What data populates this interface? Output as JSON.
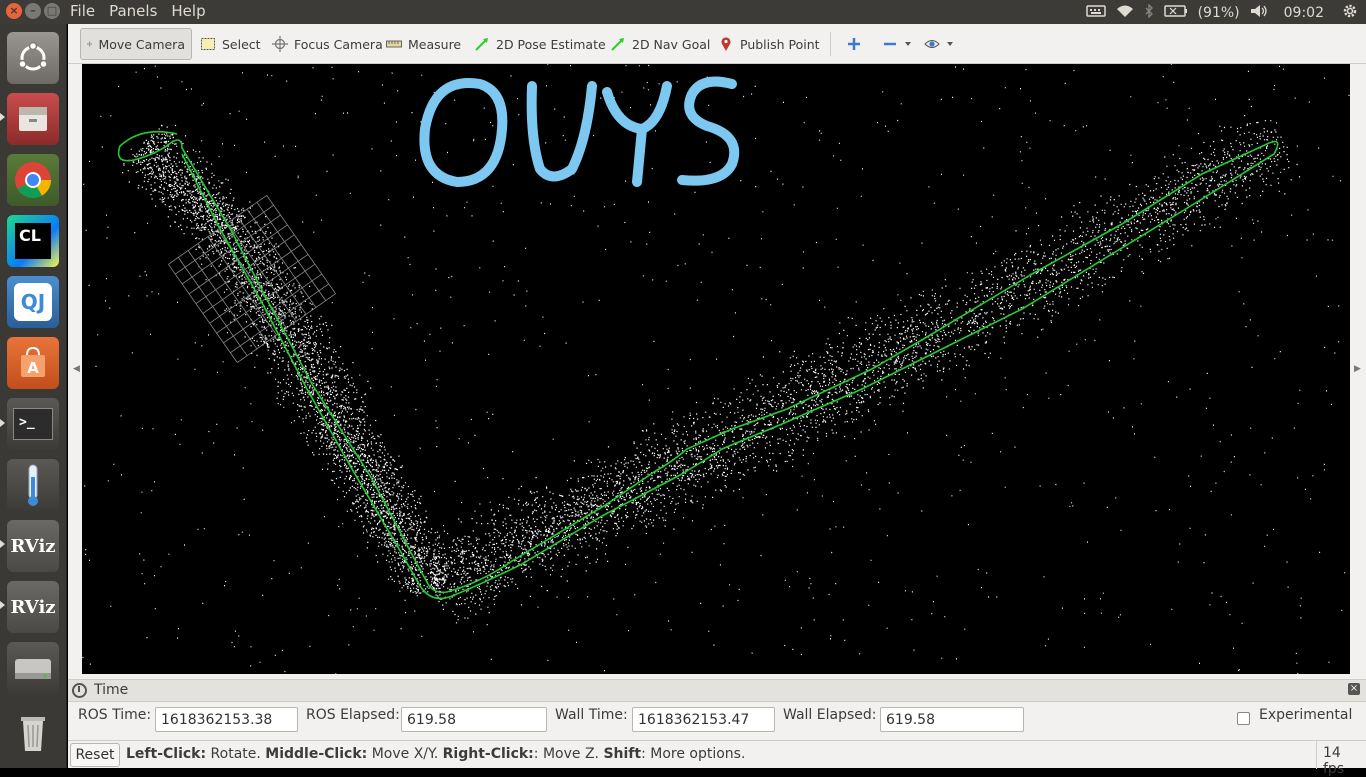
{
  "topbar": {
    "menu": [
      "File",
      "Panels",
      "Help"
    ],
    "battery": "(91%)",
    "clock": "09:02"
  },
  "launcher": {
    "items": [
      {
        "name": "ubuntu-dash-icon",
        "label": ""
      },
      {
        "name": "files-icon",
        "label": ""
      },
      {
        "name": "chrome-icon",
        "label": ""
      },
      {
        "name": "clion-icon",
        "label": "CL"
      },
      {
        "name": "qt-icon",
        "label": "QJ"
      },
      {
        "name": "software-center-icon",
        "label": "A"
      },
      {
        "name": "terminal-icon",
        "label": ">_"
      },
      {
        "name": "thermometer-icon",
        "label": ""
      },
      {
        "name": "rviz-icon-1",
        "label": "RViz"
      },
      {
        "name": "rviz-icon-2",
        "label": "RViz"
      },
      {
        "name": "disk-icon",
        "label": ""
      },
      {
        "name": "trash-icon",
        "label": ""
      }
    ]
  },
  "toolbar": {
    "move_camera": "Move Camera",
    "select": "Select",
    "focus_camera": "Focus Camera",
    "measure": "Measure",
    "pose_estimate": "2D Pose Estimate",
    "nav_goal": "2D Nav Goal",
    "publish_point": "Publish Point"
  },
  "viewport": {
    "annotation": "OUYS",
    "annotation_color": "#7cc8f0",
    "path_color": "#22cc33",
    "points_color": "#ffffff",
    "grid_color": "#8a8a8a"
  },
  "time_panel": {
    "title": "Time",
    "ros_time_label": "ROS Time:",
    "ros_time": "1618362153.38",
    "ros_elapsed_label": "ROS Elapsed:",
    "ros_elapsed": "619.58",
    "wall_time_label": "Wall Time:",
    "wall_time": "1618362153.47",
    "wall_elapsed_label": "Wall Elapsed:",
    "wall_elapsed": "619.58",
    "experimental_label": "Experimental"
  },
  "statusbar": {
    "reset": "Reset",
    "hint_left_b": "Left-Click:",
    "hint_left": " Rotate. ",
    "hint_mid_b": "Middle-Click:",
    "hint_mid": " Move X/Y. ",
    "hint_right_b": "Right-Click:",
    "hint_right": ": Move Z. ",
    "hint_shift_b": "Shift",
    "hint_shift": ": More options.",
    "fps": "14 fps"
  }
}
